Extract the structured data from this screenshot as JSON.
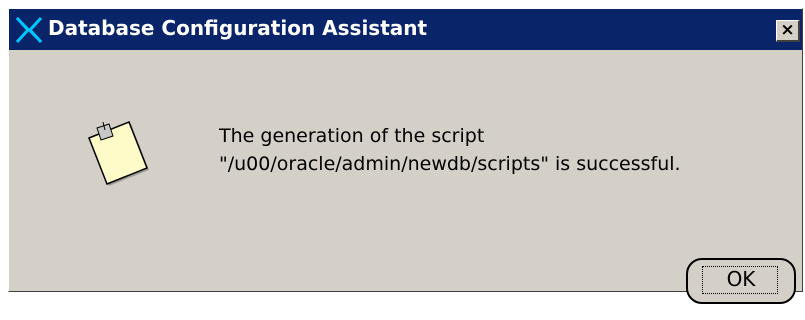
{
  "window": {
    "title": "Database Configuration Assistant",
    "close_label": "×",
    "colors": {
      "titlebar": "#0a246a",
      "face": "#d4d0c8",
      "title_text": "#ffffff"
    }
  },
  "icons": {
    "app": "oracle-x-logo-icon",
    "message": "note-icon"
  },
  "message": {
    "line1": "The generation of the script",
    "line2": "\"/u00/oracle/admin/newdb/scripts\" is successful."
  },
  "buttons": {
    "ok_label": "OK"
  }
}
